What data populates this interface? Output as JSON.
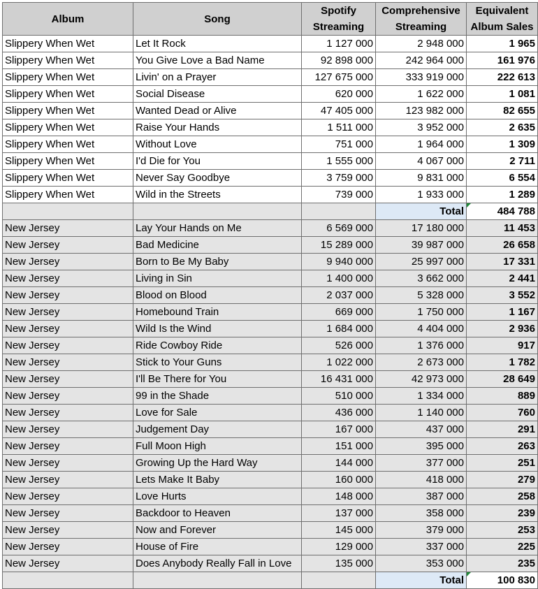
{
  "headers": {
    "album": "Album",
    "song": "Song",
    "spotify_1": "Spotify",
    "spotify_2": "Streaming",
    "comp_1": "Comprehensive",
    "comp_2": "Streaming",
    "eq_1": "Equivalent",
    "eq_2": "Album Sales"
  },
  "sections": [
    {
      "rows": [
        {
          "album": "Slippery When Wet",
          "song": "Let It Rock",
          "spotify": "1 127 000",
          "comprehensive": "2 948 000",
          "equivalent": "1 965"
        },
        {
          "album": "Slippery When Wet",
          "song": "You Give Love a Bad Name",
          "spotify": "92 898 000",
          "comprehensive": "242 964 000",
          "equivalent": "161 976"
        },
        {
          "album": "Slippery When Wet",
          "song": "Livin' on a Prayer",
          "spotify": "127 675 000",
          "comprehensive": "333 919 000",
          "equivalent": "222 613"
        },
        {
          "album": "Slippery When Wet",
          "song": "Social Disease",
          "spotify": "620 000",
          "comprehensive": "1 622 000",
          "equivalent": "1 081"
        },
        {
          "album": "Slippery When Wet",
          "song": "Wanted Dead or Alive",
          "spotify": "47 405 000",
          "comprehensive": "123 982 000",
          "equivalent": "82 655"
        },
        {
          "album": "Slippery When Wet",
          "song": "Raise Your Hands",
          "spotify": "1 511 000",
          "comprehensive": "3 952 000",
          "equivalent": "2 635"
        },
        {
          "album": "Slippery When Wet",
          "song": "Without Love",
          "spotify": "751 000",
          "comprehensive": "1 964 000",
          "equivalent": "1 309"
        },
        {
          "album": "Slippery When Wet",
          "song": "I'd Die for You",
          "spotify": "1 555 000",
          "comprehensive": "4 067 000",
          "equivalent": "2 711"
        },
        {
          "album": "Slippery When Wet",
          "song": "Never Say Goodbye",
          "spotify": "3 759 000",
          "comprehensive": "9 831 000",
          "equivalent": "6 554"
        },
        {
          "album": "Slippery When Wet",
          "song": "Wild in the Streets",
          "spotify": "739 000",
          "comprehensive": "1 933 000",
          "equivalent": "1 289"
        }
      ],
      "total_label": "Total",
      "total_value": "484 788"
    },
    {
      "rows": [
        {
          "album": "New Jersey",
          "song": "Lay Your Hands on Me",
          "spotify": "6 569 000",
          "comprehensive": "17 180 000",
          "equivalent": "11 453"
        },
        {
          "album": "New Jersey",
          "song": "Bad Medicine",
          "spotify": "15 289 000",
          "comprehensive": "39 987 000",
          "equivalent": "26 658"
        },
        {
          "album": "New Jersey",
          "song": "Born to Be My Baby",
          "spotify": "9 940 000",
          "comprehensive": "25 997 000",
          "equivalent": "17 331"
        },
        {
          "album": "New Jersey",
          "song": "Living in Sin",
          "spotify": "1 400 000",
          "comprehensive": "3 662 000",
          "equivalent": "2 441"
        },
        {
          "album": "New Jersey",
          "song": "Blood on Blood",
          "spotify": "2 037 000",
          "comprehensive": "5 328 000",
          "equivalent": "3 552"
        },
        {
          "album": "New Jersey",
          "song": "Homebound Train",
          "spotify": "669 000",
          "comprehensive": "1 750 000",
          "equivalent": "1 167"
        },
        {
          "album": "New Jersey",
          "song": "Wild Is the Wind",
          "spotify": "1 684 000",
          "comprehensive": "4 404 000",
          "equivalent": "2 936"
        },
        {
          "album": "New Jersey",
          "song": "Ride Cowboy Ride",
          "spotify": "526 000",
          "comprehensive": "1 376 000",
          "equivalent": "917"
        },
        {
          "album": "New Jersey",
          "song": "Stick to Your Guns",
          "spotify": "1 022 000",
          "comprehensive": "2 673 000",
          "equivalent": "1 782"
        },
        {
          "album": "New Jersey",
          "song": "I'll Be There for You",
          "spotify": "16 431 000",
          "comprehensive": "42 973 000",
          "equivalent": "28 649"
        },
        {
          "album": "New Jersey",
          "song": "99 in the Shade",
          "spotify": "510 000",
          "comprehensive": "1 334 000",
          "equivalent": "889"
        },
        {
          "album": "New Jersey",
          "song": "Love for Sale",
          "spotify": "436 000",
          "comprehensive": "1 140 000",
          "equivalent": "760"
        },
        {
          "album": "New Jersey",
          "song": "Judgement Day",
          "spotify": "167 000",
          "comprehensive": "437 000",
          "equivalent": "291"
        },
        {
          "album": "New Jersey",
          "song": "Full Moon High",
          "spotify": "151 000",
          "comprehensive": "395 000",
          "equivalent": "263"
        },
        {
          "album": "New Jersey",
          "song": "Growing Up the Hard Way",
          "spotify": "144 000",
          "comprehensive": "377 000",
          "equivalent": "251"
        },
        {
          "album": "New Jersey",
          "song": "Lets Make It Baby",
          "spotify": "160 000",
          "comprehensive": "418 000",
          "equivalent": "279"
        },
        {
          "album": "New Jersey",
          "song": "Love Hurts",
          "spotify": "148 000",
          "comprehensive": "387 000",
          "equivalent": "258"
        },
        {
          "album": "New Jersey",
          "song": "Backdoor to Heaven",
          "spotify": "137 000",
          "comprehensive": "358 000",
          "equivalent": "239"
        },
        {
          "album": "New Jersey",
          "song": "Now and Forever",
          "spotify": "145 000",
          "comprehensive": "379 000",
          "equivalent": "253"
        },
        {
          "album": "New Jersey",
          "song": "House of Fire",
          "spotify": "129 000",
          "comprehensive": "337 000",
          "equivalent": "225"
        },
        {
          "album": "New Jersey",
          "song": "Does Anybody Really Fall in Love",
          "spotify": "135 000",
          "comprehensive": "353 000",
          "equivalent": "235"
        }
      ],
      "total_label": "Total",
      "total_value": "100 830"
    }
  ]
}
